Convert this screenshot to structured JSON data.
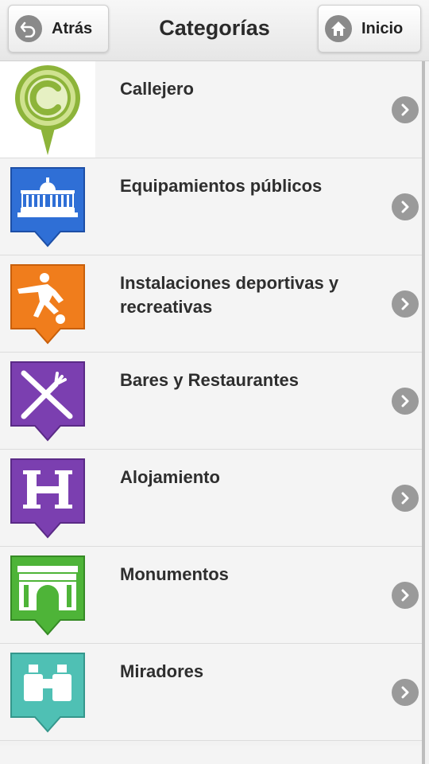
{
  "header": {
    "back_label": "Atrás",
    "title": "Categorías",
    "home_label": "Inicio"
  },
  "colors": {
    "callejero": "#8db43a",
    "equipamientos": "#2f6fd6",
    "instalaciones": "#f07d1c",
    "bares": "#7b3fb0",
    "alojamiento": "#7b3fb0",
    "monumentos": "#4eb438",
    "miradores": "#4fc0b4"
  },
  "categories": [
    {
      "label": "Callejero",
      "icon": "callejero-pin-icon"
    },
    {
      "label": "Equipamientos públicos",
      "icon": "public-building-icon"
    },
    {
      "label": "Instalaciones deportivas y recreativas",
      "icon": "soccer-player-icon"
    },
    {
      "label": "Bares y Restaurantes",
      "icon": "knife-fork-icon"
    },
    {
      "label": "Alojamiento",
      "icon": "hotel-h-icon"
    },
    {
      "label": "Monumentos",
      "icon": "arch-monument-icon"
    },
    {
      "label": "Miradores",
      "icon": "binoculars-icon"
    }
  ]
}
